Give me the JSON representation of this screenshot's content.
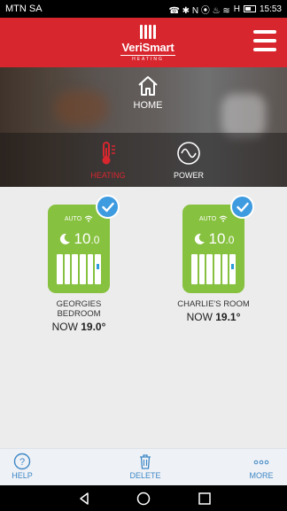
{
  "status_bar": {
    "carrier": "MTN SA",
    "icons": "☎ ✱ N ⦿ ♨ ≋",
    "network": "H",
    "time": "15:53"
  },
  "header": {
    "brand": "VeriSmart",
    "brand_sub": "HEATING",
    "menu_icon": "hamburger-icon"
  },
  "tabs": {
    "home": {
      "label": "HOME",
      "icon": "home-icon"
    },
    "heating": {
      "label": "HEATING",
      "icon": "thermometer-icon"
    },
    "power": {
      "label": "POWER",
      "icon": "power-wave-icon"
    }
  },
  "rooms": [
    {
      "mode": "AUTO",
      "temp_whole": "10",
      "temp_frac": ".0",
      "name": "GEORGIES BEDROOM",
      "now_label": "NOW",
      "now_value": "19.0°"
    },
    {
      "mode": "AUTO",
      "temp_whole": "10",
      "temp_frac": ".0",
      "name": "CHARLIE'S ROOM",
      "now_label": "NOW",
      "now_value": "19.1°"
    }
  ],
  "bottom_bar": {
    "help": "HELP",
    "delete": "DELETE",
    "more": "MORE"
  },
  "colors": {
    "brand_red": "#d8262e",
    "tile_green": "#86c13f",
    "accent_blue": "#3e9be0"
  }
}
